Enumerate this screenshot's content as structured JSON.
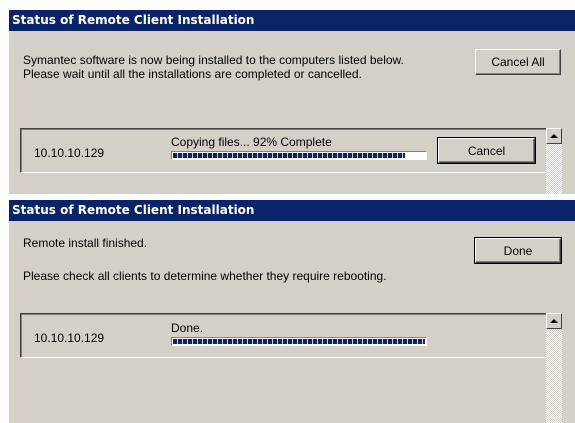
{
  "top_dialog": {
    "title": "Status of Remote Client Installation",
    "message_line1": "Symantec software is now being installed to the computers listed below.",
    "message_line2": "Please wait until all the installations are completed or cancelled.",
    "cancel_all_label": "Cancel All",
    "client": {
      "ip": "10.10.10.129",
      "status": "Copying files... 92% Complete",
      "progress": 0.92,
      "cancel_label": "Cancel"
    }
  },
  "bottom_dialog": {
    "title": "Status of Remote Client Installation",
    "message_line1": "Remote install finished.",
    "message_line2": "Please check all clients to determine whether they require rebooting.",
    "done_label": "Done",
    "client": {
      "ip": "10.10.10.129",
      "status": "Done.",
      "progress": 1.0
    }
  },
  "colors": {
    "titlebar": "#0a246a",
    "face": "#d4d0c8",
    "progress": "#0a246a"
  },
  "icons": {
    "scroll_up": "scroll-up-arrow-icon"
  }
}
